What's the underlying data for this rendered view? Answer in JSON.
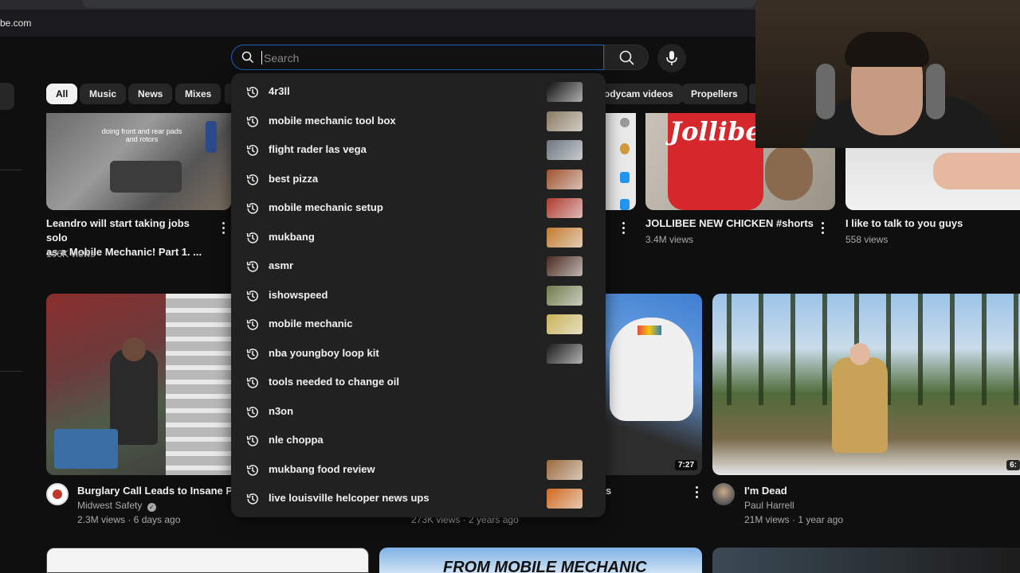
{
  "browser": {
    "url_fragment": "be.com"
  },
  "search": {
    "placeholder": "Search",
    "value": ""
  },
  "chips": [
    "All",
    "Music",
    "News",
    "Mixes",
    "odycam videos",
    "Propellers"
  ],
  "suggestions": [
    {
      "text": "4r3ll",
      "has_thumb": true,
      "thumb_color": "#111111"
    },
    {
      "text": "mobile mechanic tool box",
      "has_thumb": true,
      "thumb_color": "#8a7b62"
    },
    {
      "text": "flight rader las vega",
      "has_thumb": true,
      "thumb_color": "#6d7680"
    },
    {
      "text": "best pizza",
      "has_thumb": true,
      "thumb_color": "#a0522d"
    },
    {
      "text": "mobile mechanic setup",
      "has_thumb": true,
      "thumb_color": "#b03a2e"
    },
    {
      "text": "mukbang",
      "has_thumb": true,
      "thumb_color": "#c47a2c"
    },
    {
      "text": "asmr",
      "has_thumb": true,
      "thumb_color": "#4a2a1e"
    },
    {
      "text": "ishowspeed",
      "has_thumb": true,
      "thumb_color": "#6f7c4c"
    },
    {
      "text": "mobile mechanic",
      "has_thumb": true,
      "thumb_color": "#c9b458"
    },
    {
      "text": "nba youngboy loop kit",
      "has_thumb": true,
      "thumb_color": "#1a1a1a"
    },
    {
      "text": "tools needed to change oil",
      "has_thumb": false
    },
    {
      "text": "n3on",
      "has_thumb": false
    },
    {
      "text": "nle choppa",
      "has_thumb": false
    },
    {
      "text": "mukbang food review",
      "has_thumb": true,
      "thumb_color": "#9c6a3c"
    },
    {
      "text": "live louisville helcoper news ups",
      "has_thumb": true,
      "thumb_color": "#d2691e"
    }
  ],
  "videos": {
    "v1": {
      "title_line1": "Leandro will start taking jobs solo",
      "title_line2": "as a Mobile Mechanic! Part 1. ...",
      "views": "106K views",
      "overlay": "doing front and rear pads\nand rotors"
    },
    "v2": {
      "title": "JOLLIBEE NEW CHICKEN #shorts",
      "views": "3.4M views"
    },
    "v3": {
      "title": "I like to talk to you guys",
      "views": "558 views"
    },
    "v4": {
      "title": "Burglary Call Leads to Insane Plo",
      "channel": "Midwest Safety",
      "meta": "2.3M views · 6 days ago"
    },
    "v5": {
      "meta": "273K views · 2 years ago",
      "duration": "7:27",
      "title_tail": "s"
    },
    "v6": {
      "title": "I'm Dead",
      "channel": "Paul Harrell",
      "meta": "21M views · 1 year ago",
      "duration": "6:"
    },
    "v7": {
      "overlay": "FROM MOBILE MECHANIC"
    }
  },
  "colors": {
    "bg": "#0f0f0f",
    "dropdown": "#212121",
    "chip": "#272727",
    "accent_border": "#1c62b9"
  }
}
